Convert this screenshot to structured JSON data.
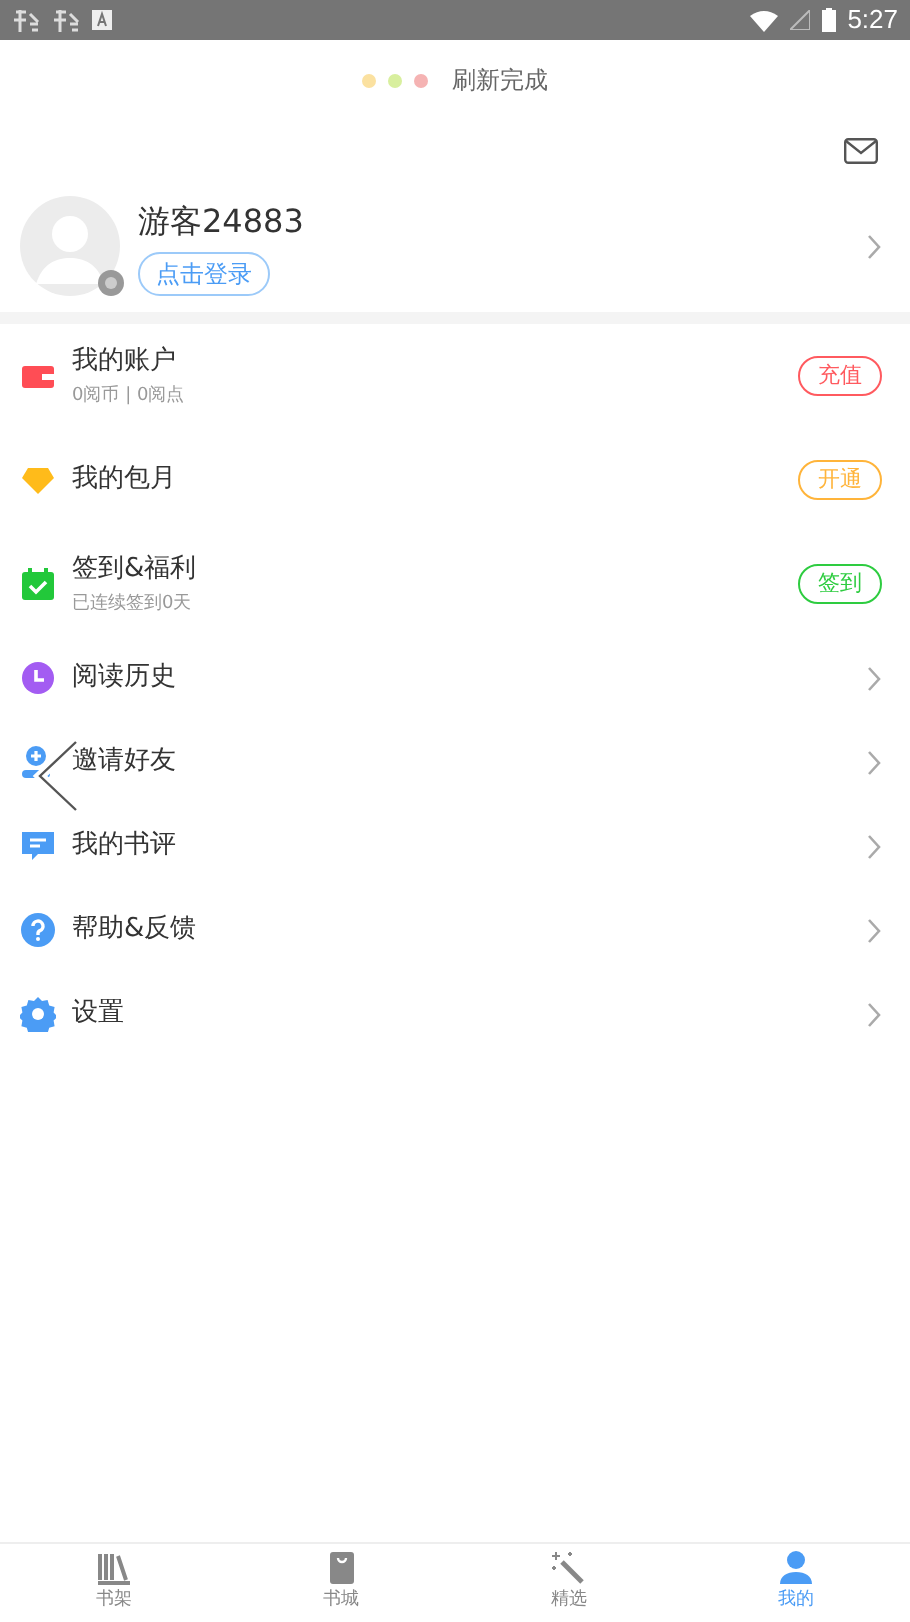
{
  "status_bar": {
    "time": "5:27"
  },
  "refresh": {
    "text": "刷新完成"
  },
  "profile": {
    "name": "游客24883",
    "login": "点击登录"
  },
  "menu": [
    {
      "kind": "action",
      "label": "我的账户",
      "subtitle": "0阅币 | 0阅点",
      "button": "充值",
      "color": "#ff5a5f"
    },
    {
      "kind": "action",
      "label": "我的包月",
      "button": "开通",
      "color": "#ffb43a"
    },
    {
      "kind": "action",
      "label": "签到&福利",
      "subtitle": "已连续签到0天",
      "button": "签到",
      "color": "#2ecc40"
    },
    {
      "kind": "link",
      "label": "阅读历史"
    },
    {
      "kind": "link",
      "label": "邀请好友"
    },
    {
      "kind": "link",
      "label": "我的书评"
    },
    {
      "kind": "link",
      "label": "帮助&反馈"
    },
    {
      "kind": "link",
      "label": "设置"
    }
  ],
  "tabs": [
    {
      "label": "书架",
      "selected": false
    },
    {
      "label": "书城",
      "selected": false
    },
    {
      "label": "精选",
      "selected": false
    },
    {
      "label": "我的",
      "selected": true
    }
  ]
}
